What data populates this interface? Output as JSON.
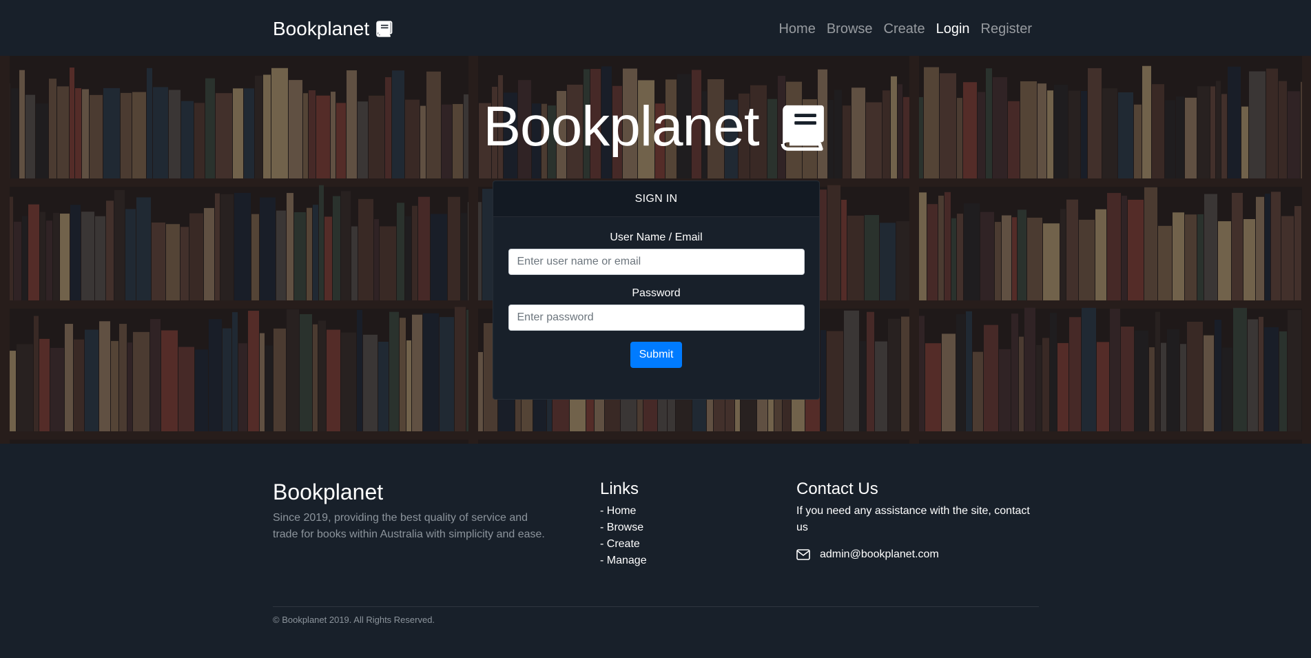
{
  "navbar": {
    "brand": "Bookplanet",
    "brand_icon": "book-icon",
    "links": [
      {
        "label": "Home",
        "active": false
      },
      {
        "label": "Browse",
        "active": false
      },
      {
        "label": "Create",
        "active": false
      },
      {
        "label": "Login",
        "active": true
      },
      {
        "label": "Register",
        "active": false
      }
    ]
  },
  "hero": {
    "title": "Bookplanet",
    "title_icon": "book-icon",
    "background": "bookshelf-photo"
  },
  "login": {
    "header": "SIGN IN",
    "username_label": "User Name / Email",
    "username_placeholder": "Enter user name or email",
    "username_value": "",
    "password_label": "Password",
    "password_placeholder": "Enter password",
    "password_value": "",
    "submit_label": "Submit"
  },
  "footer": {
    "brand": "Bookplanet",
    "description": "Since 2019, providing the best quality of service and trade for books within Australia with simplicity and ease.",
    "links_title": "Links",
    "links": [
      "- Home",
      "- Browse",
      "- Create",
      "- Manage"
    ],
    "contact_title": "Contact Us",
    "contact_text": "If you need any assistance with the site, contact us",
    "email_icon": "envelope-icon",
    "email": "admin@bookplanet.com",
    "copyright": "© Bookplanet 2019. All Rights Reserved."
  },
  "colors": {
    "background": "#18202a",
    "primary": "#007bff",
    "muted_text": "#8c949c"
  }
}
